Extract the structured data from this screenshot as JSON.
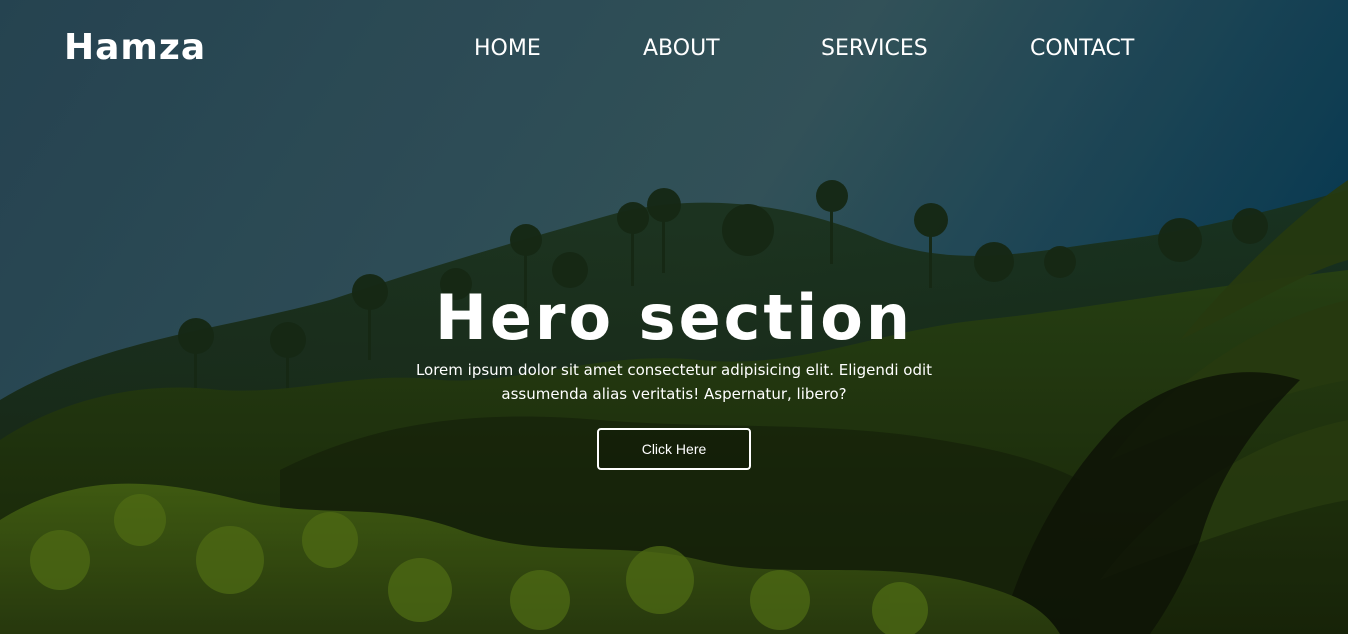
{
  "brand": {
    "logo_text": "Hamza"
  },
  "nav": {
    "items": [
      {
        "label": "HOME"
      },
      {
        "label": "ABOUT"
      },
      {
        "label": "SERVICES"
      },
      {
        "label": "CONTACT"
      }
    ]
  },
  "hero": {
    "title": "Hero section",
    "text": "Lorem ipsum dolor sit amet consectetur adipisicing elit. Eligendi odit assumenda alias veritatis! Aspernatur, libero?",
    "button_label": "Click Here"
  },
  "colors": {
    "text": "#ffffff",
    "sky_top": "#2f5868",
    "sky_bottom": "#3a5f62",
    "foliage_dark": "#1a2a10",
    "foliage_light": "#5a7a18"
  }
}
